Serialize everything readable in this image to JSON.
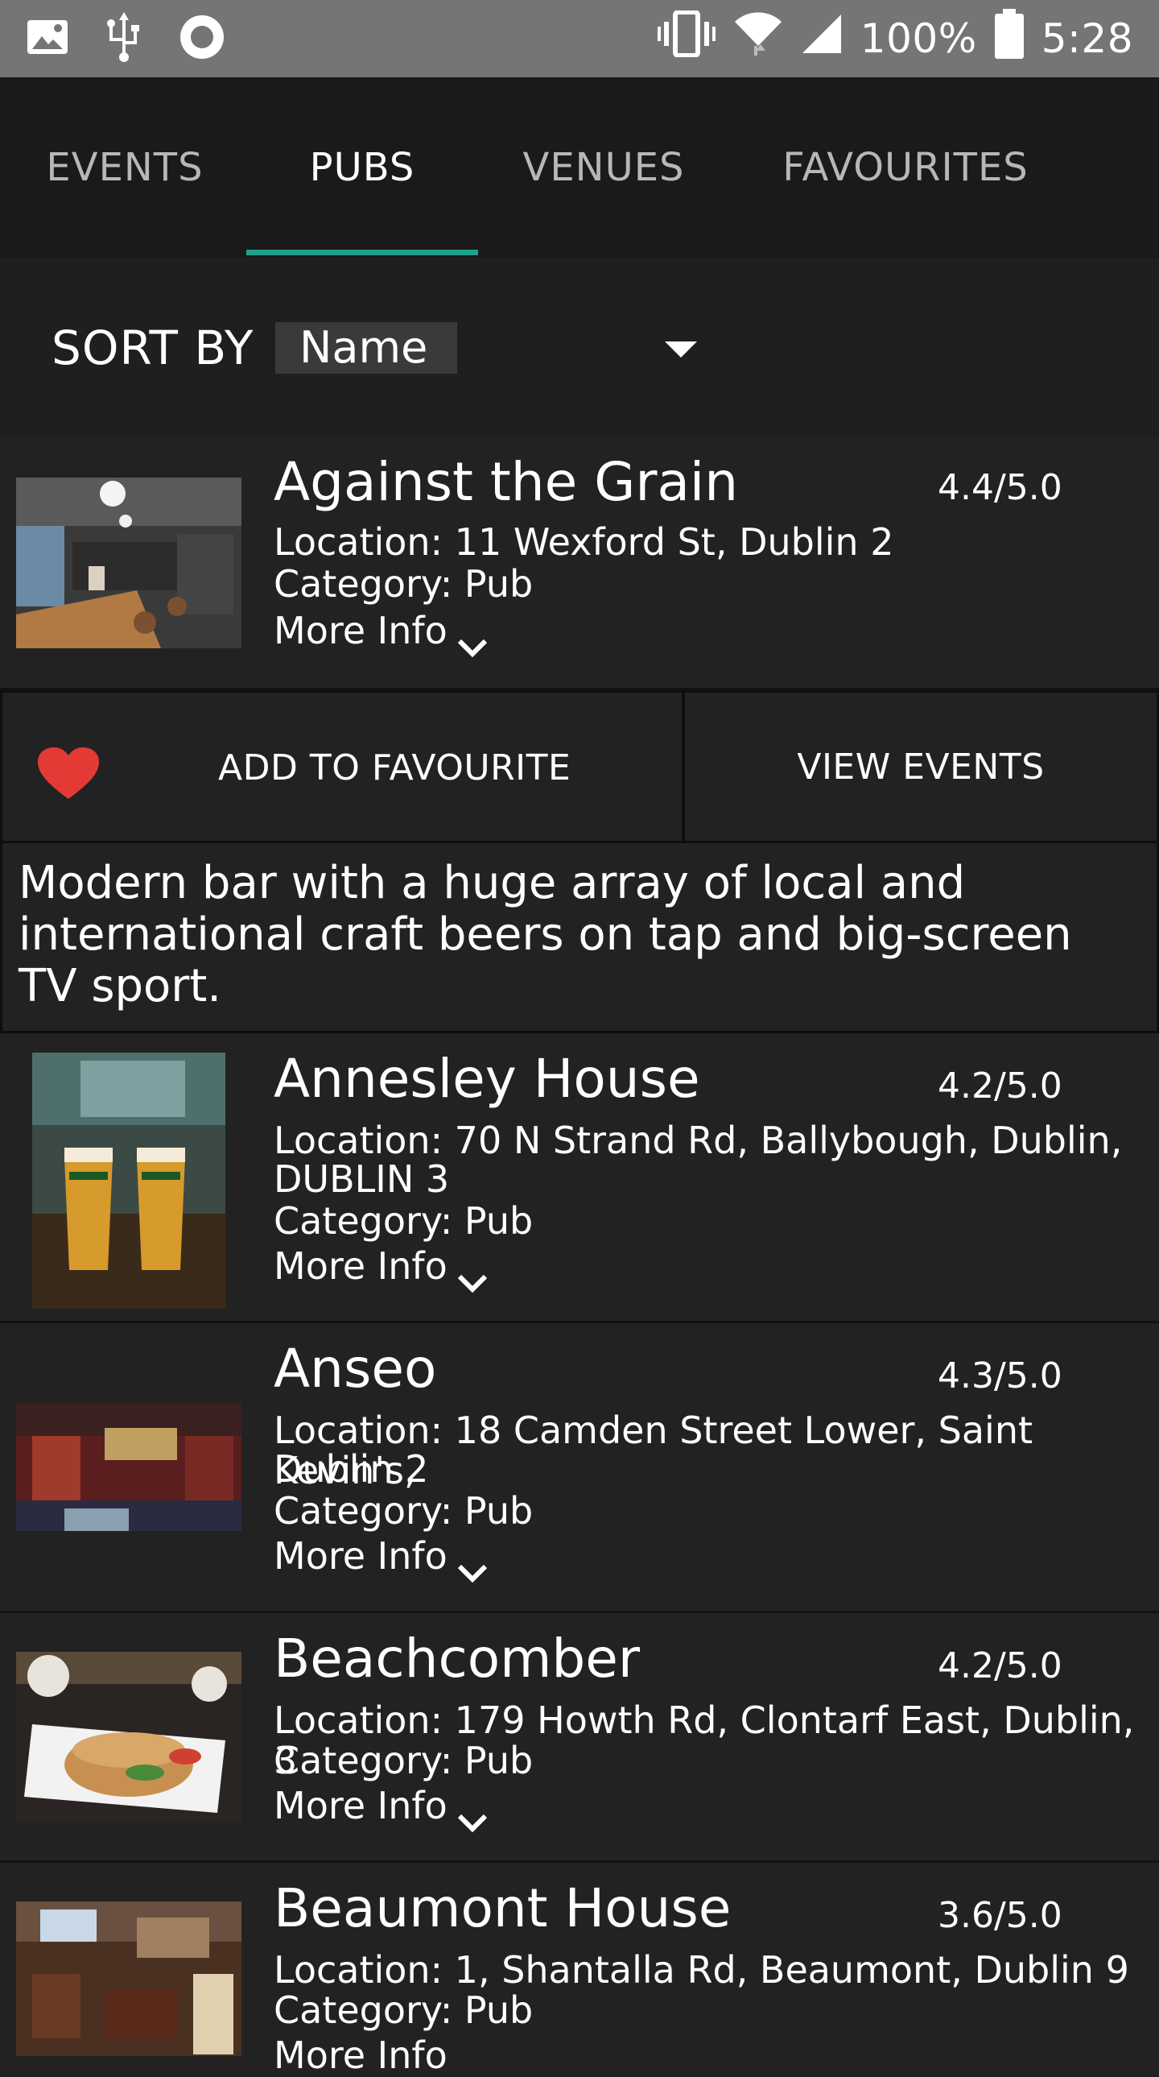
{
  "statusbar": {
    "battery": "100%",
    "time": "5:28"
  },
  "tabs": [
    {
      "label": "EVENTS",
      "active": false
    },
    {
      "label": "PUBS",
      "active": true
    },
    {
      "label": "VENUES",
      "active": false
    },
    {
      "label": "FAVOURITES",
      "active": false
    }
  ],
  "sort": {
    "label": "SORT BY",
    "value": "Name"
  },
  "colors": {
    "accent": "#1fa28a",
    "heart": "#e53935",
    "background": "#222222"
  },
  "pubs": [
    {
      "name": "Against the Grain",
      "rating": "4.4/5.0",
      "location": "Location: 11 Wexford St, Dublin 2",
      "category": "Category: Pub",
      "more": "More Info",
      "expanded": true,
      "actions": {
        "favourite": "ADD TO FAVOURITE",
        "events": "VIEW EVENTS"
      },
      "description": "Modern bar with a huge array of local and international craft beers on tap and big-screen TV sport."
    },
    {
      "name": "Annesley House",
      "rating": "4.2/5.0",
      "location_l1": "Location: 70 N Strand Rd, Ballybough, Dublin,",
      "location_l2": "DUBLIN 3",
      "category": "Category: Pub",
      "more": "More Info"
    },
    {
      "name": "Anseo",
      "rating": "4.3/5.0",
      "location_l1": "Location: 18 Camden Street Lower, Saint Kevin's,",
      "location_l2": "Dublin 2",
      "category": "Category: Pub",
      "more": "More Info"
    },
    {
      "name": "Beachcomber",
      "rating": "4.2/5.0",
      "location": "Location: 179 Howth Rd, Clontarf East, Dublin, 3",
      "category": "Category: Pub",
      "more": "More Info"
    },
    {
      "name": "Beaumont House",
      "rating": "3.6/5.0",
      "location": "Location: 1, Shantalla Rd, Beaumont, Dublin 9",
      "category": "Category: Pub",
      "more": "More Info"
    }
  ]
}
